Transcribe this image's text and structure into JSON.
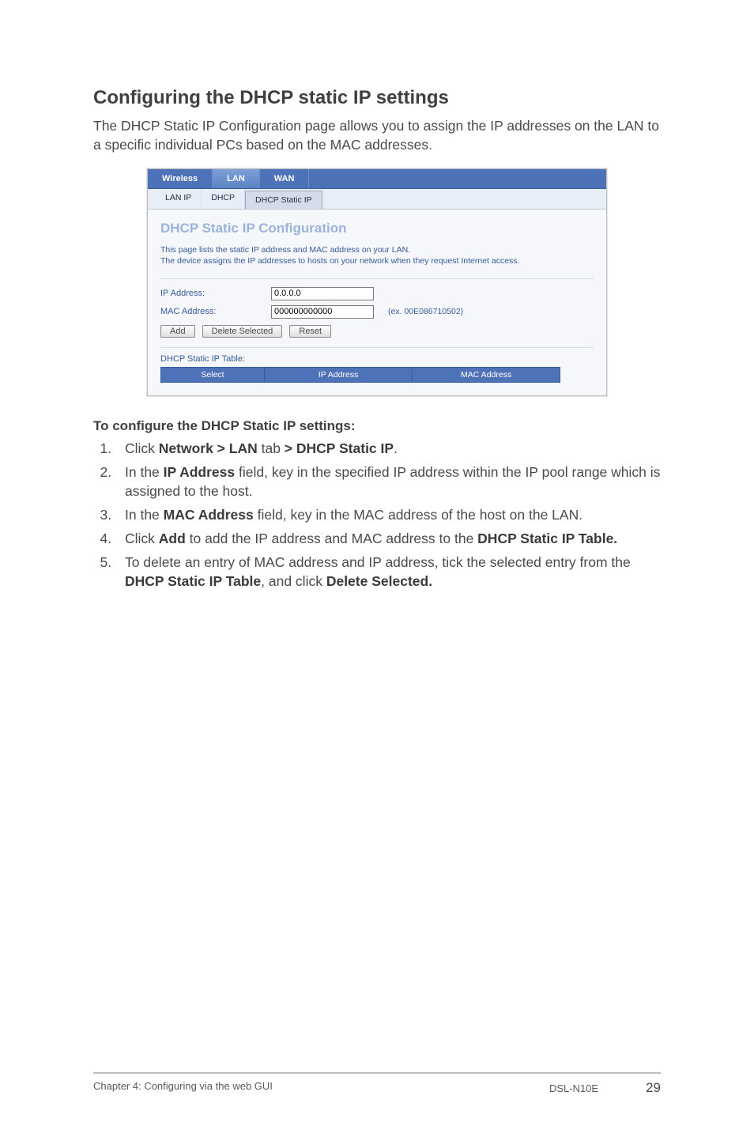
{
  "section": {
    "title": "Configuring the DHCP static IP settings",
    "intro": "The DHCP Static IP Configuration page allows you to assign the IP addresses on the LAN to a specific individual PCs based on the MAC addresses."
  },
  "router": {
    "main_tabs": {
      "wireless": "Wireless",
      "lan": "LAN",
      "wan": "WAN"
    },
    "sub_tabs": {
      "lan_ip": "LAN IP",
      "dhcp": "DHCP",
      "dhcp_static_ip": "DHCP Static IP"
    },
    "panel_title": "DHCP Static IP Configuration",
    "desc_line1": "This page lists the static IP address and MAC address on your LAN.",
    "desc_line2": "The device assigns the IP addresses to hosts on your network when they request Internet access.",
    "fields": {
      "ip_label": "IP Address:",
      "ip_value": "0.0.0.0",
      "mac_label": "MAC Address:",
      "mac_value": "000000000000",
      "mac_hint": "(ex. 00E086710502)"
    },
    "buttons": {
      "add": "Add",
      "delete_selected": "Delete Selected",
      "reset": "Reset"
    },
    "table": {
      "caption": "DHCP Static IP Table:",
      "col_select": "Select",
      "col_ip": "IP Address",
      "col_mac": "MAC Address"
    }
  },
  "instructions": {
    "heading": "To configure the DHCP Static IP settings:",
    "step1_a": "Click ",
    "step1_b": "Network > LAN",
    "step1_c": " tab ",
    "step1_d": "> DHCP Static IP",
    "step1_e": ".",
    "step2_a": "In the ",
    "step2_b": "IP Address",
    "step2_c": " field, key in the specified IP address within the IP pool range which is assigned to the host.",
    "step3_a": "In the ",
    "step3_b": "MAC Address",
    "step3_c": " field, key in the MAC address of the host on the LAN.",
    "step4_a": "Click ",
    "step4_b": "Add",
    "step4_c": " to add the IP address and MAC address to the ",
    "step4_d": "DHCP Static IP Table.",
    "step5_a": "To delete an entry of MAC address and IP address, tick the selected entry from the ",
    "step5_b": "DHCP Static IP Table",
    "step5_c": ", and click ",
    "step5_d": "Delete Selected."
  },
  "footer": {
    "left": "Chapter 4: Configuring via the web GUI",
    "model": "DSL-N10E",
    "page": "29"
  }
}
